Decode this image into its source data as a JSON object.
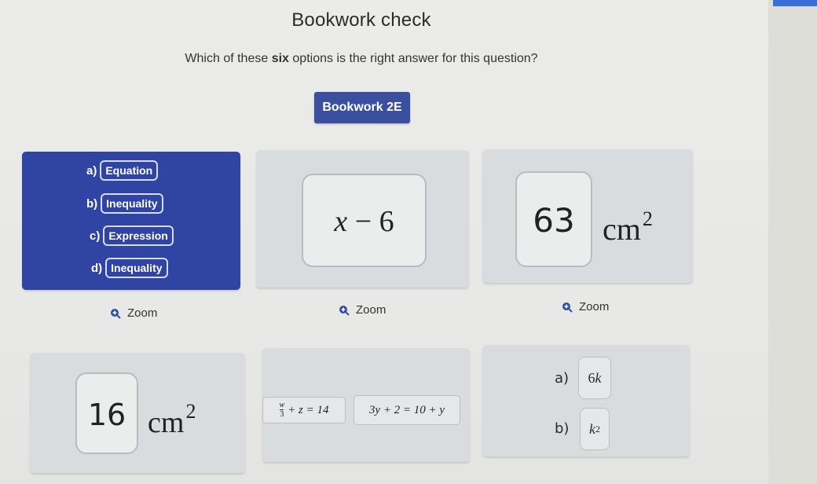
{
  "header": {
    "title": "Bookwork check",
    "question_prefix": "Which of these ",
    "question_bold": "six",
    "question_suffix": " options is the right answer for this question?",
    "bookwork_code": "Bookwork 2E"
  },
  "options": {
    "option1": {
      "selected": true,
      "rows": [
        {
          "letter": "a)",
          "label": "Equation"
        },
        {
          "letter": "b)",
          "label": "Inequality"
        },
        {
          "letter": "c)",
          "label": "Expression"
        },
        {
          "letter": "d)",
          "label": "Inequality"
        }
      ]
    },
    "option2": {
      "var": "x",
      "op": "−",
      "num": "6"
    },
    "option3": {
      "value": "63",
      "unit": "cm",
      "power": "2"
    },
    "option4": {
      "value": "16",
      "unit": "cm",
      "power": "2"
    },
    "option5": {
      "eq1": {
        "frac_num": "w",
        "frac_den": "3",
        "rest": "+ z = 14"
      },
      "eq2": "3y + 2 = 10 + y"
    },
    "option6": {
      "a": {
        "letter": "a)",
        "coef": "6",
        "var": "k"
      },
      "b": {
        "letter": "b)",
        "var": "k",
        "power": "2"
      }
    }
  },
  "zoom_links": [
    "Zoom",
    "Zoom",
    "Zoom"
  ],
  "colors": {
    "selected_card": "#2f44a3",
    "bookwork_button": "#3b4fa0",
    "zoom_icon": "#2e4fa0"
  }
}
